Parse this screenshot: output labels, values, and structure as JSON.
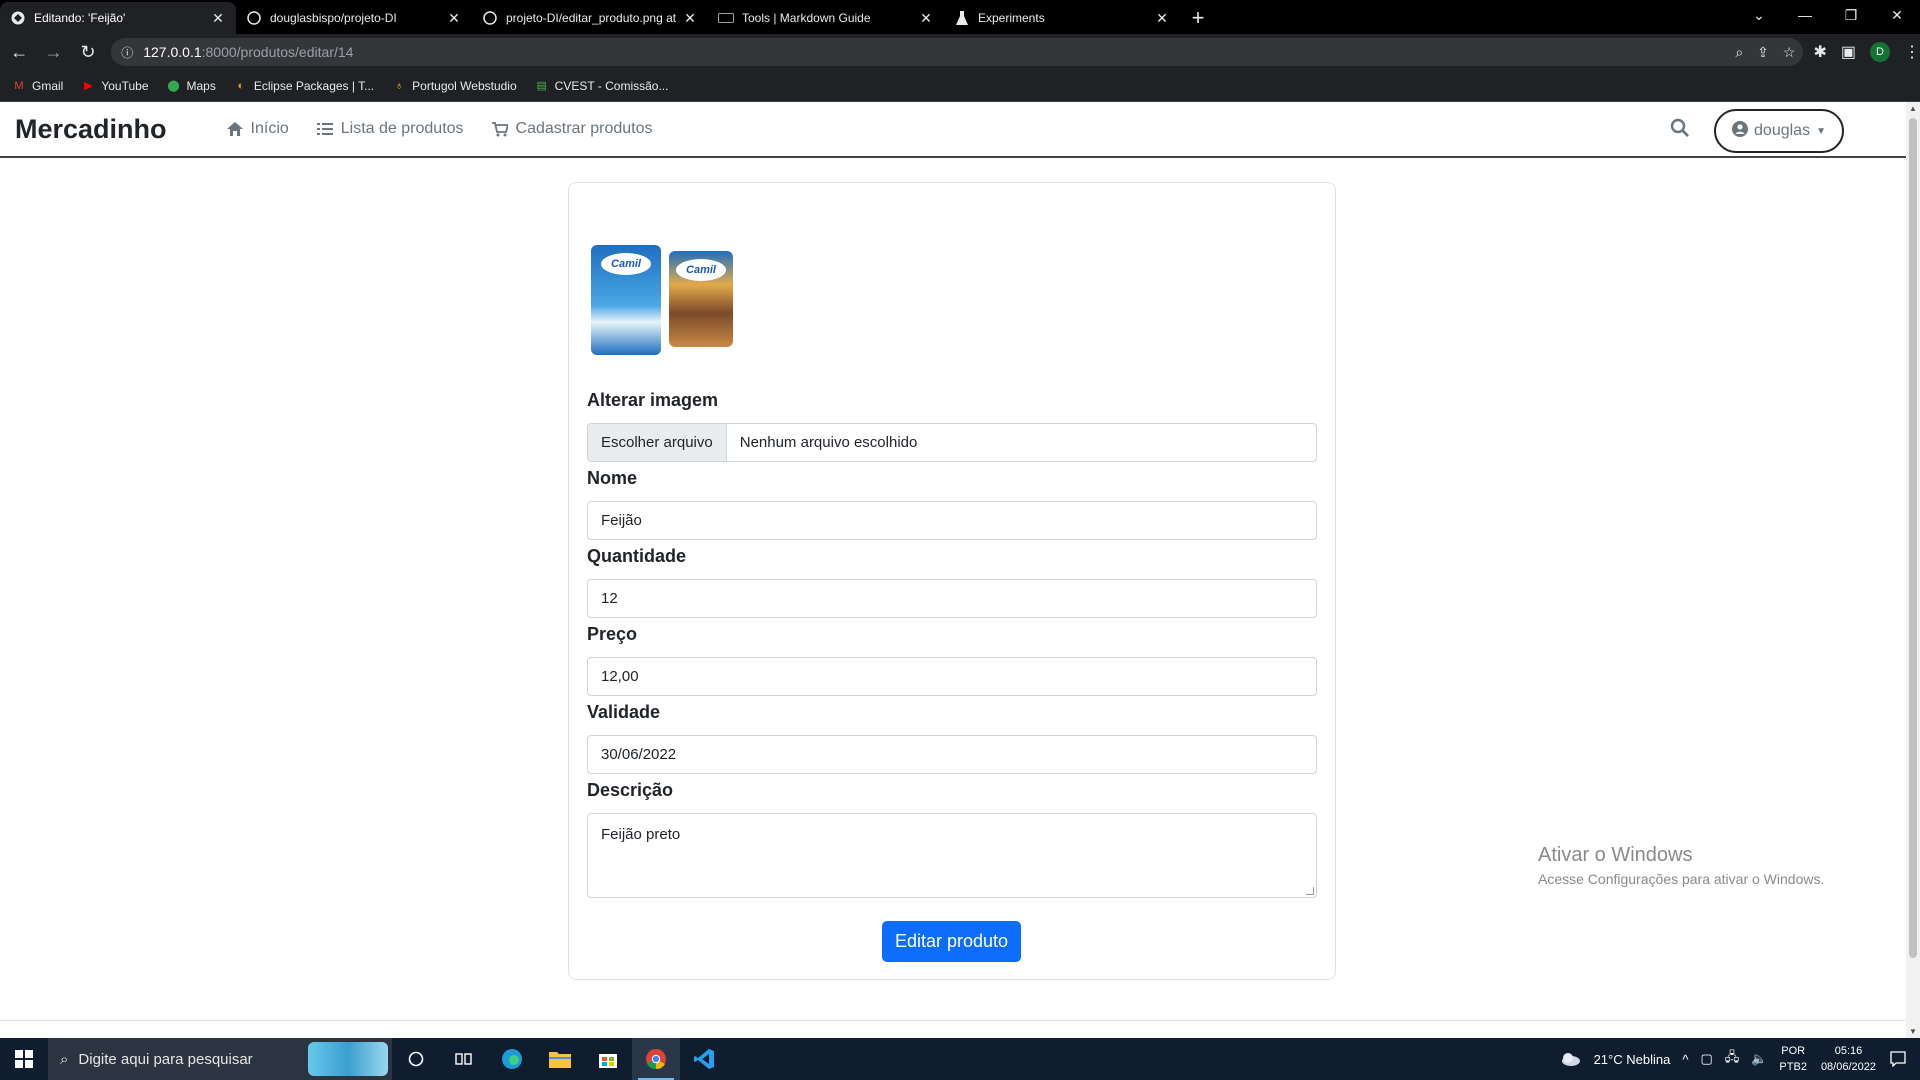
{
  "browser": {
    "tabs": [
      {
        "title": "Editando: 'Feijão'",
        "active": true,
        "icon": "site-icon"
      },
      {
        "title": "douglasbispo/projeto-DI",
        "active": false,
        "icon": "github-icon"
      },
      {
        "title": "projeto-DI/editar_produto.png at",
        "active": false,
        "icon": "github-icon"
      },
      {
        "title": "Tools | Markdown Guide",
        "active": false,
        "icon": "markdown-icon"
      },
      {
        "title": "Experiments",
        "active": false,
        "icon": "flask-icon"
      }
    ],
    "url_host": "127.0.0.1",
    "url_rest": ":8000/produtos/editar/14",
    "profile_initial": "D",
    "bookmarks": [
      {
        "label": "Gmail",
        "icon": "gmail-icon",
        "color": "#ea4335"
      },
      {
        "label": "YouTube",
        "icon": "youtube-icon",
        "color": "#ff0000"
      },
      {
        "label": "Maps",
        "icon": "maps-icon",
        "color": "#34a853"
      },
      {
        "label": "Eclipse Packages | T...",
        "icon": "eclipse-icon",
        "color": "#f7941e"
      },
      {
        "label": "Portugol Webstudio",
        "icon": "portugol-icon",
        "color": "#f2c600"
      },
      {
        "label": "CVEST - Comissão...",
        "icon": "cvest-icon",
        "color": "#4caf50"
      }
    ]
  },
  "navbar": {
    "brand": "Mercadinho",
    "links": [
      {
        "label": "Início",
        "icon": "home-icon"
      },
      {
        "label": "Lista de produtos",
        "icon": "list-icon"
      },
      {
        "label": "Cadastrar produtos",
        "icon": "cart-icon"
      }
    ],
    "user": "douglas"
  },
  "form": {
    "image_brand": "Camil",
    "image_label": "Alterar imagem",
    "file_button": "Escolher arquivo",
    "file_status": "Nenhum arquivo escolhido",
    "name_label": "Nome",
    "name_value": "Feijão",
    "quantity_label": "Quantidade",
    "quantity_value": "12",
    "price_label": "Preço",
    "price_value": "12,00",
    "expiry_label": "Validade",
    "expiry_value": "30/06/2022",
    "description_label": "Descrição",
    "description_value": "Feijão preto",
    "submit_label": "Editar produto"
  },
  "watermark": {
    "line1": "Ativar o Windows",
    "line2": "Acesse Configurações para ativar o Windows."
  },
  "taskbar": {
    "search_placeholder": "Digite aqui para pesquisar",
    "weather": "21°C  Neblina",
    "lang_line1": "POR",
    "lang_line2": "PTB2",
    "time": "05:16",
    "date": "08/06/2022"
  },
  "colors": {
    "primary": "#0d6efd",
    "taskbar": "#101d2f",
    "browser_dark": "#202124"
  }
}
